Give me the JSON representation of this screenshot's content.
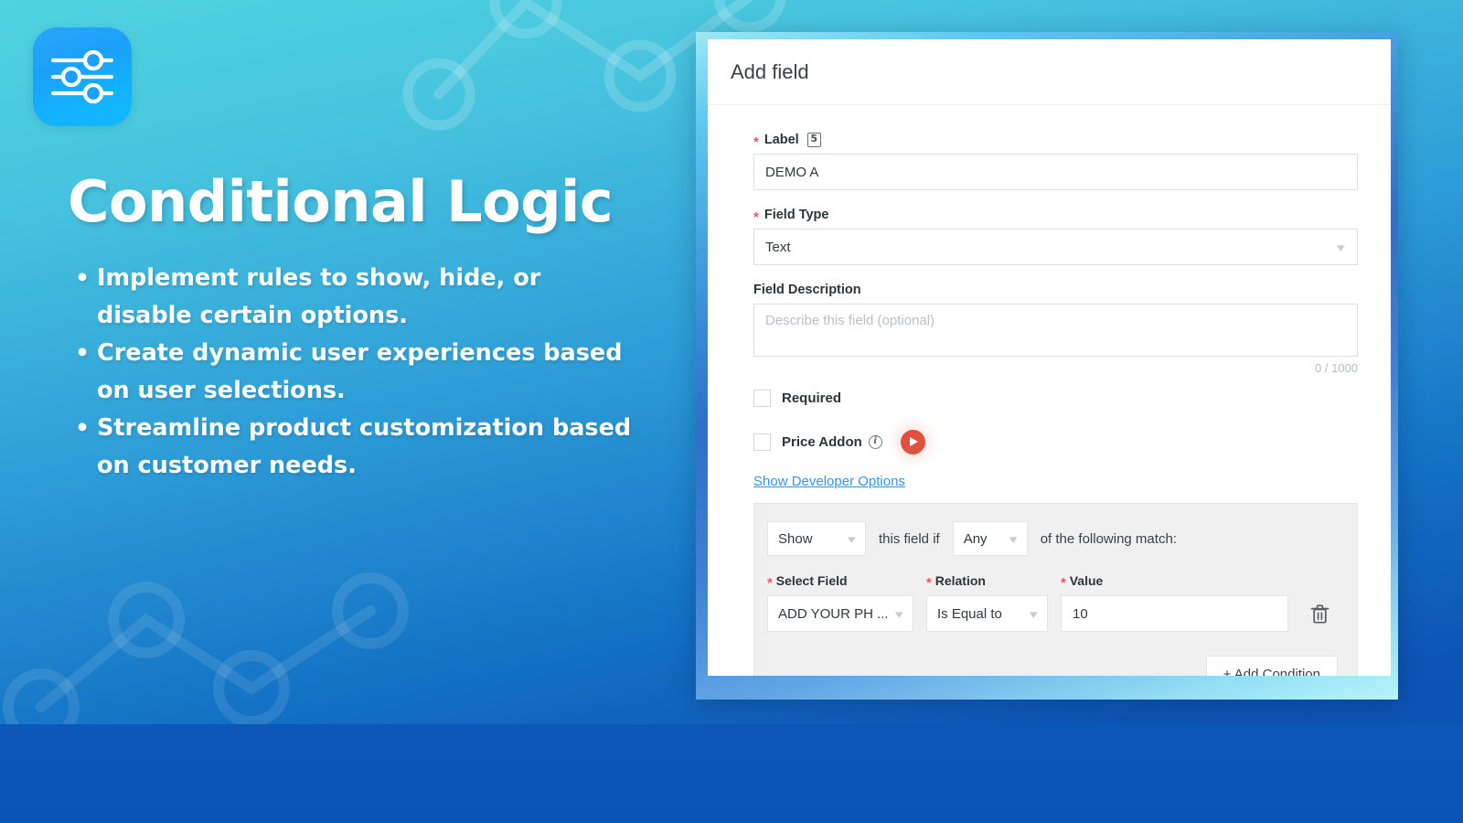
{
  "theme": {
    "bg_top": "#4fd3e0",
    "bg_bottom": "#0a51b2",
    "accent_red": "#f5515f",
    "link_blue": "#3a93e0",
    "play_red": "#e0503c"
  },
  "left": {
    "logo_icon": "sliders-icon",
    "headline": "Conditional Logic",
    "bullets": [
      "Implement rules to show, hide, or disable certain options.",
      "Create dynamic user experiences based on user selections.",
      "Streamline product customization based on customer needs."
    ]
  },
  "card": {
    "title": "Add field",
    "label_field": {
      "label": "Label",
      "required_marker": "*",
      "badge_icon": "html5-icon",
      "value": "DEMO A"
    },
    "field_type": {
      "label": "Field Type",
      "required_marker": "*",
      "value": "Text",
      "chevron": "chevron-down-icon"
    },
    "field_description": {
      "label": "Field Description",
      "placeholder": "Describe this field (optional)",
      "value": "",
      "counter": "0 / 1000"
    },
    "required_checkbox": {
      "label": "Required",
      "checked": false
    },
    "price_addon_checkbox": {
      "label": "Price Addon",
      "checked": false,
      "info_icon": "info-icon",
      "play_icon": "play-icon"
    },
    "developer_options_link": "Show Developer Options",
    "conditional": {
      "action": "Show",
      "mid_text": "this field if",
      "match_mode": "Any",
      "tail_text": "of the following match:",
      "columns": {
        "select_field": "Select Field",
        "relation": "Relation",
        "value": "Value",
        "required_marker": "*"
      },
      "rows": [
        {
          "select_field": "ADD YOUR PH ...",
          "relation": "Is Equal to",
          "value": "10",
          "delete_icon": "trash-icon"
        }
      ],
      "add_condition_label": "+ Add Condition"
    }
  }
}
